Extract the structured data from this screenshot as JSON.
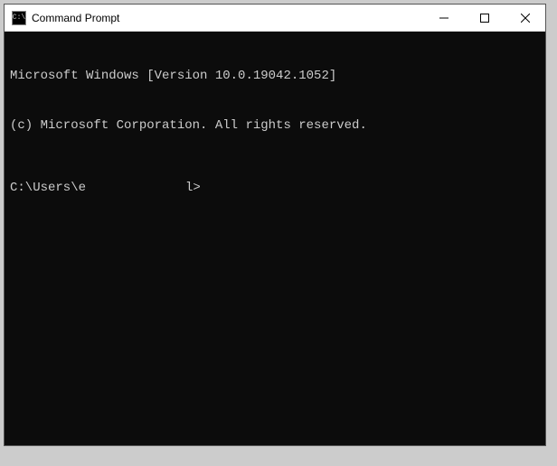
{
  "window": {
    "title": "Command Prompt",
    "icon_label": "cmd-icon"
  },
  "terminal": {
    "line1": "Microsoft Windows [Version 10.0.19042.1052]",
    "line2": "(c) Microsoft Corporation. All rights reserved.",
    "prompt_prefix": "C:\\Users\\e",
    "prompt_suffix": "l>"
  },
  "controls": {
    "minimize": "Minimize",
    "maximize": "Maximize",
    "close": "Close"
  }
}
